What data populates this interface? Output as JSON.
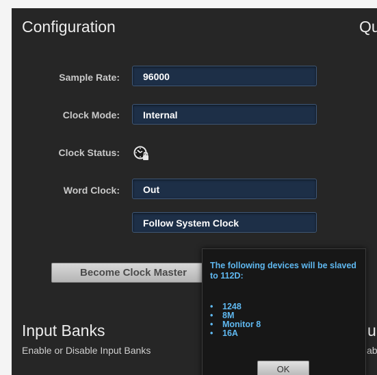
{
  "configuration": {
    "title": "Configuration",
    "right_title_fragment": "Qu",
    "sample_rate": {
      "label": "Sample Rate:",
      "value": "96000"
    },
    "clock_mode": {
      "label": "Clock Mode:",
      "value": "Internal"
    },
    "clock_status": {
      "label": "Clock Status:",
      "icon": "clock-lock-icon"
    },
    "word_clock": {
      "label": "Word Clock:",
      "value": "Out",
      "follow_value": "Follow System Clock"
    },
    "become_master_label": "Become Clock Master"
  },
  "input_banks": {
    "title": "Input Banks",
    "subtitle": "Enable or Disable Input Banks",
    "right_title_fragment": "u",
    "right_subtitle_fragment": "ab"
  },
  "popup": {
    "message": "The following devices will be slaved to 112D:",
    "devices": [
      "1248",
      "8M",
      "Monitor 8",
      "16A"
    ],
    "bullet": "•",
    "ok_label": "OK"
  },
  "colors": {
    "background": "#262626",
    "select_bg": "#1d2f47",
    "popup_text": "#5fb8f0"
  }
}
